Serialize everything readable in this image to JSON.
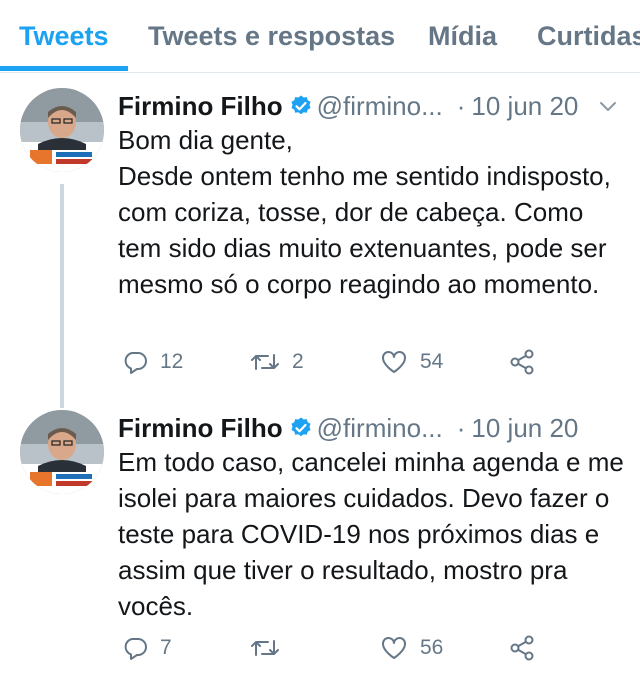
{
  "tabs": [
    {
      "label": "Tweets",
      "active": true
    },
    {
      "label": "Tweets e respostas",
      "active": false
    },
    {
      "label": "Mídia",
      "active": false
    },
    {
      "label": "Curtidas",
      "active": false
    }
  ],
  "colors": {
    "accent": "#1da1f2",
    "secondary_text": "#657786",
    "divider": "#e1e8ed"
  },
  "tweets": [
    {
      "name": "Firmino Filho",
      "handle": "@firmino...",
      "separator": "·",
      "date": "10 jun 20",
      "verified_icon": "verified-badge-icon",
      "text": "Bom dia gente,\nDesde ontem tenho me sentido indisposto, com coriza, tosse, dor de cabeça. Como tem sido dias muito extenuantes, pode ser mesmo só o corpo reagindo ao momento.",
      "replies": "12",
      "retweets": "2",
      "likes": "54"
    },
    {
      "name": "Firmino Filho",
      "handle": "@firmino...",
      "separator": "·",
      "date": "10 jun 20",
      "verified_icon": "verified-badge-icon",
      "text": "Em todo caso, cancelei minha agenda e me isolei para maiores cuidados. Devo fazer o teste para COVID-19 nos próximos dias e assim que tiver o resultado, mostro pra vocês.",
      "replies": "7",
      "retweets": "",
      "likes": "56"
    }
  ]
}
